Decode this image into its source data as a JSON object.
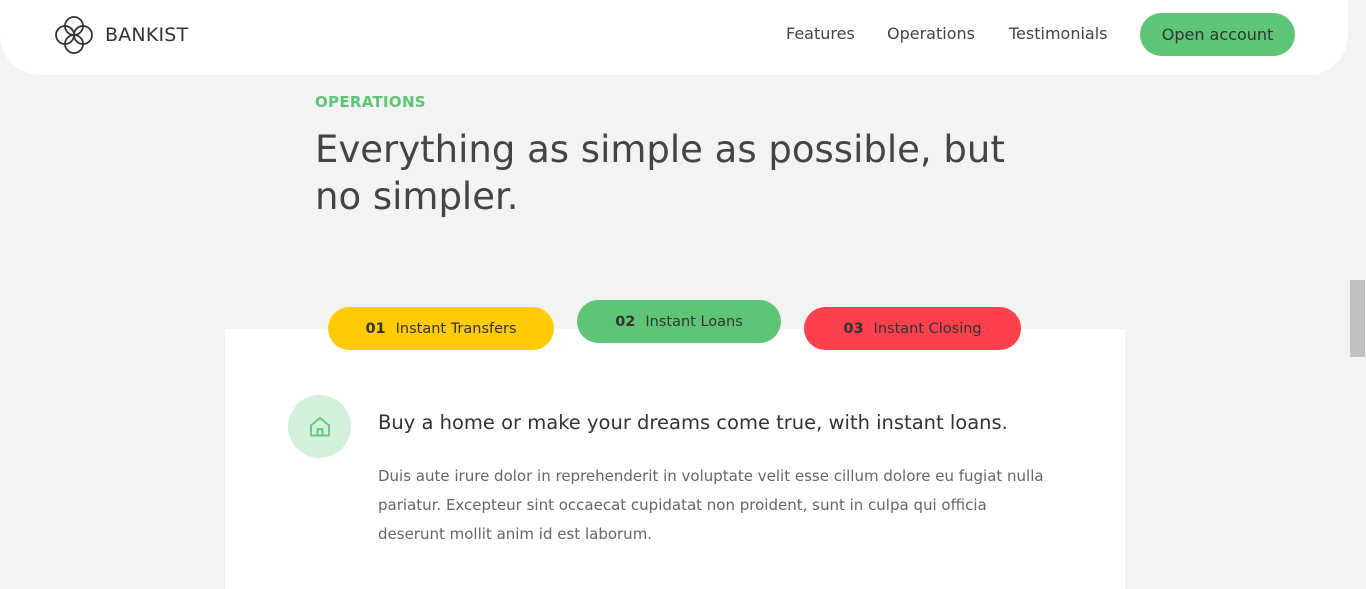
{
  "nav": {
    "brand": "BANKIST",
    "links": [
      "Features",
      "Operations",
      "Testimonials"
    ],
    "cta": "Open account"
  },
  "section": {
    "tag": "OPERATIONS",
    "title": "Everything as simple as possible, but no simpler."
  },
  "tabs": [
    {
      "num": "01",
      "label": "Instant Transfers",
      "color": "#ffcb03"
    },
    {
      "num": "02",
      "label": "Instant Loans",
      "color": "#5ec576"
    },
    {
      "num": "03",
      "label": "Instant Closing",
      "color": "#ff414d"
    }
  ],
  "content": {
    "icon": "home-icon",
    "title": "Buy a home or make your dreams come true, with instant loans.",
    "text": "Duis aute irure dolor in reprehenderit in voluptate velit esse cillum dolore eu fugiat nulla pariatur. Excepteur sint occaecat cupidatat non proident, sunt in culpa qui officia deserunt mollit anim id est laborum."
  },
  "colors": {
    "accent": "#5ec576",
    "yellow": "#ffcb03",
    "red": "#ff414d"
  }
}
